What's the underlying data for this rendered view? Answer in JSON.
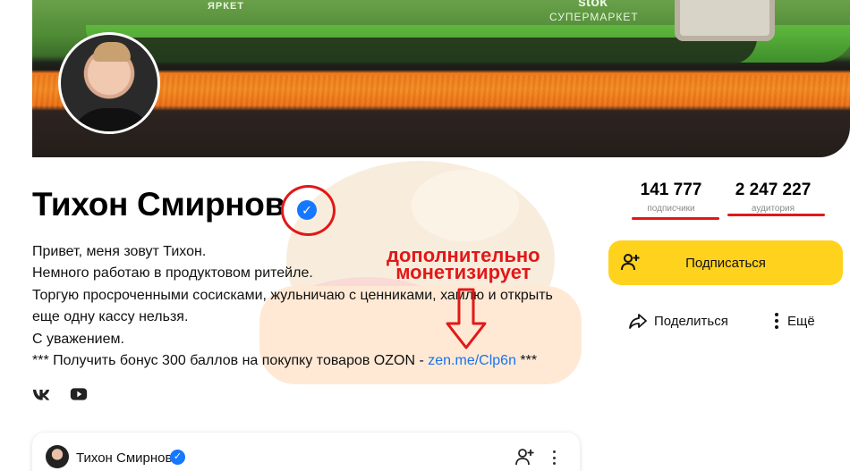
{
  "cover": {
    "brand_left": "ЯРКЕТ",
    "brand_right_top": "stok",
    "brand_right": "СУПЕРМАРКЕТ"
  },
  "profile": {
    "name": "Тихон Смирнов",
    "verified": true,
    "description_lines": [
      "Привет, меня зовут Тихон.",
      "Немного работаю в продуктовом ритейле.",
      "Торгую просроченными сосисками, жульничаю с ценниками, хамлю и открыть",
      "еще одну кассу нельзя.",
      "С уважением."
    ],
    "promo_prefix": "*** Получить бонус 300 баллов на покупку товаров OZON - ",
    "promo_link": "zen.me/Clp6n",
    "promo_suffix": " ***",
    "social": [
      "vk-icon",
      "youtube-icon"
    ]
  },
  "stats": {
    "subscribers_value": "141 777",
    "subscribers_label": "подписчики",
    "audience_value": "2 247 227",
    "audience_label": "аудитория"
  },
  "actions": {
    "subscribe_label": "Подписаться",
    "share_label": "Поделиться",
    "more_label": "Ещё"
  },
  "annotation": {
    "line1": "дополнительно",
    "line2": "монетизирует",
    "color": "#e21818"
  },
  "post_card": {
    "author_name": "Тихон Смирнов",
    "verified": true
  },
  "colors": {
    "accent_yellow": "#ffd21e",
    "verified_blue": "#1677ff",
    "link_blue": "#1a73e8"
  }
}
